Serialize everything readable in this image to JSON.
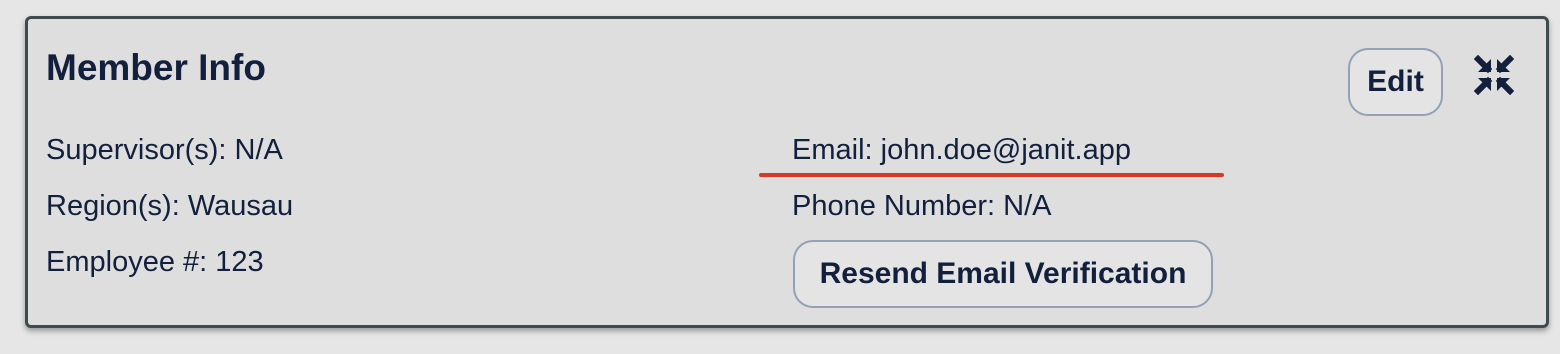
{
  "card": {
    "title": "Member Info",
    "edit_label": "Edit",
    "collapse_icon": "compress-arrows-icon",
    "left_fields": {
      "supervisor": "Supervisor(s): N/A",
      "region": "Region(s): Wausau",
      "employee": "Employee #: 123"
    },
    "right_fields": {
      "email": "Email: john.doe@janit.app",
      "phone": "Phone Number: N/A"
    },
    "resend_label": "Resend Email Verification",
    "highlight_color": "#d63a24"
  }
}
